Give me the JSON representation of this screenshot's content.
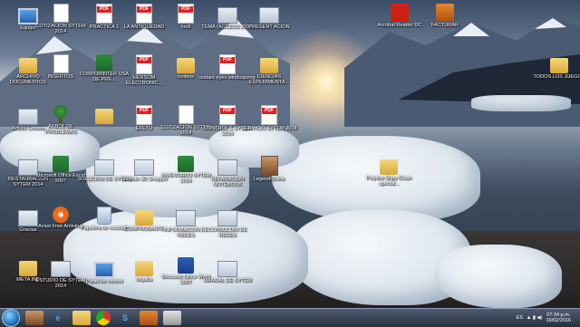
{
  "desktop_icons": [
    {
      "label": "Equipo",
      "kind": "mon"
    },
    {
      "label": "COTIZACION SYTEM 2014",
      "kind": "doc"
    },
    {
      "label": "PRACTICA 1",
      "kind": "pdf"
    },
    {
      "label": "LA ANTIGUEDAD",
      "kind": "pdf"
    },
    {
      "label": "Ioo9",
      "kind": "pdf"
    },
    {
      "label": "TEMA (ACCESS 2007)",
      "kind": "gen"
    },
    {
      "label": "PRESENT ACION",
      "kind": "gen"
    },
    {
      "label": "Acrobat Reader DC",
      "kind": "acrobat"
    },
    {
      "label": "FACTURAR",
      "kind": "factura"
    },
    {
      "label": "ARCHIVO DOCUMENTOS",
      "kind": "folder"
    },
    {
      "label": "INSERTOS",
      "kind": "doc"
    },
    {
      "label": "CORPORINTER USA DE PRE...",
      "kind": "xls"
    },
    {
      "label": "HERSOM ELECTRONIC...",
      "kind": "pdf"
    },
    {
      "label": "runtime",
      "kind": "folder"
    },
    {
      "label": "instant eyes windospeng",
      "kind": "pdf"
    },
    {
      "label": "CIENCIAS EXPERIMENTA...",
      "kind": "folder"
    },
    {
      "label": "TODOS LOS JUEGOS",
      "kind": "folder"
    },
    {
      "label": "Artistic Lenses",
      "kind": "gen"
    },
    {
      "label": "ÁRBOL DE PROBLEMAS",
      "kind": "tree"
    },
    {
      "label": "",
      "kind": "folder"
    },
    {
      "label": "EFETU",
      "kind": "pdf"
    },
    {
      "label": "COTIZACION SYTEM 2014",
      "kind": "doc"
    },
    {
      "label": "CONTROL 1 SYTEM 2014",
      "kind": "pdf"
    },
    {
      "label": "SERVICIO SYTEM 2014",
      "kind": "pdf"
    },
    {
      "label": "RESTAURACION SYTEM 2014",
      "kind": "gen"
    },
    {
      "label": "Microsoft Office Excel 2007",
      "kind": "xls"
    },
    {
      "label": "SOLUCION DE SYTEM",
      "kind": "gen"
    },
    {
      "label": "Shoptile 3D Shopper",
      "kind": "gen"
    },
    {
      "label": "INVENTARIO SYTEM 2014",
      "kind": "xls"
    },
    {
      "label": "REPARACION NOTEBOOK",
      "kind": "gen"
    },
    {
      "label": "LegendOnline",
      "kind": "game"
    },
    {
      "label": "Polyline Shpy Clean special...",
      "kind": "folder"
    },
    {
      "label": "Gracias",
      "kind": "gen"
    },
    {
      "label": "Avast Free Antivirus",
      "kind": "avast"
    },
    {
      "label": "Papelera de reciclaje",
      "kind": "bin"
    },
    {
      "label": "COMPROBANTE",
      "kind": "folder"
    },
    {
      "label": "INFORMACION DE REDES",
      "kind": "gen"
    },
    {
      "label": "CONSULTAS DE REDES",
      "kind": "gen"
    },
    {
      "label": "META INF",
      "kind": "folder"
    },
    {
      "label": "ESTUDIO DE SYTEM 2014",
      "kind": "gen"
    },
    {
      "label": "Panel de control",
      "kind": "mon"
    },
    {
      "label": "tequilla",
      "kind": "folder"
    },
    {
      "label": "Microsoft Office Word 2007",
      "kind": "word"
    },
    {
      "label": "MANUAL DE SYTEM",
      "kind": "gen"
    }
  ],
  "taskbar": {
    "items": [
      "game-icon",
      "ie-icon",
      "folder-icon",
      "chrome-icon",
      "skype-icon",
      "app-icon",
      "app-icon"
    ],
    "language": "ES",
    "time": "07:34 p.m.",
    "date": "19/02/2016"
  }
}
